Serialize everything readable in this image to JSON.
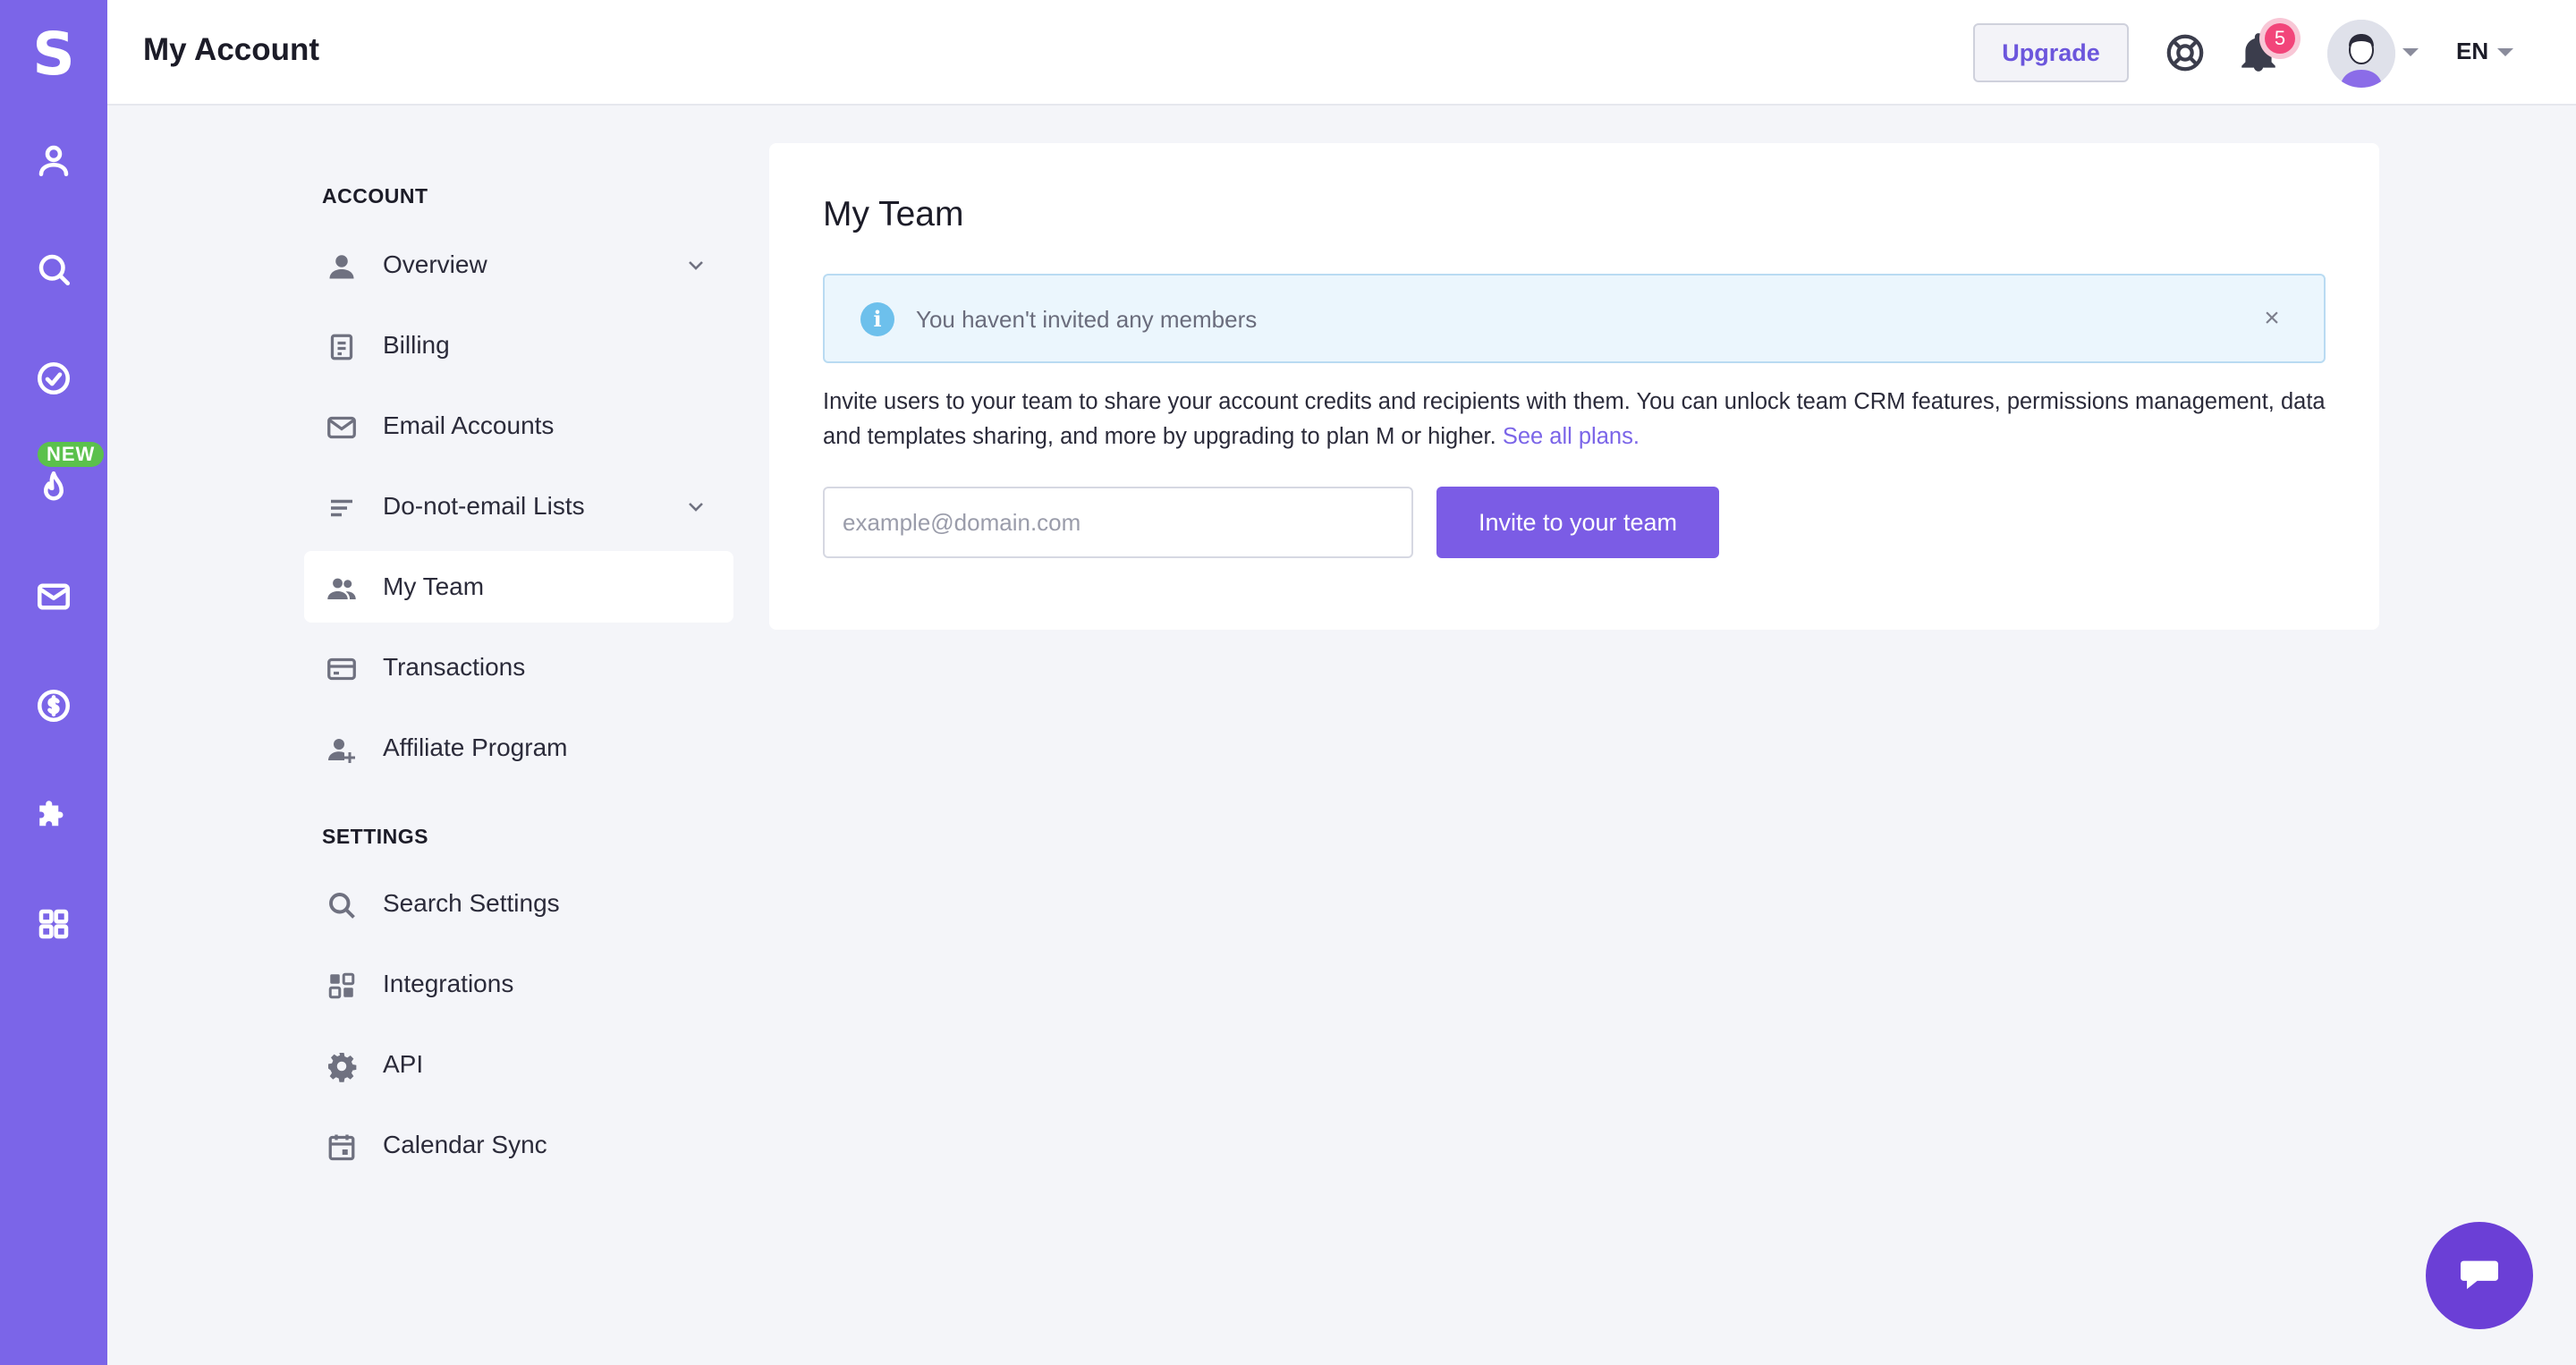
{
  "rail": {
    "logo": "S",
    "new_badge": "NEW",
    "items": [
      {
        "icon": "user-icon"
      },
      {
        "icon": "search-icon"
      },
      {
        "icon": "check-circle-icon"
      },
      {
        "icon": "flame-icon"
      },
      {
        "icon": "mail-icon"
      },
      {
        "icon": "dollar-icon"
      },
      {
        "icon": "puzzle-icon"
      },
      {
        "icon": "apps-grid-icon"
      }
    ],
    "color": "#7b65e8"
  },
  "header": {
    "title": "My Account",
    "upgrade_label": "Upgrade",
    "notification_count": "5",
    "language": "EN"
  },
  "nav": {
    "account_heading": "ACCOUNT",
    "settings_heading": "SETTINGS",
    "account_items": [
      {
        "label": "Overview",
        "icon": "person-icon"
      },
      {
        "label": "Billing",
        "icon": "document-icon"
      },
      {
        "label": "Email Accounts",
        "icon": "envelope-icon"
      },
      {
        "label": "Do-not-email Lists",
        "icon": "list-icon"
      },
      {
        "label": "My Team",
        "icon": "team-icon"
      },
      {
        "label": "Transactions",
        "icon": "card-icon"
      },
      {
        "label": "Affiliate Program",
        "icon": "person-add-icon"
      }
    ],
    "settings_items": [
      {
        "label": "Search Settings",
        "icon": "magnifier-icon"
      },
      {
        "label": "Integrations",
        "icon": "integrations-icon"
      },
      {
        "label": "API",
        "icon": "gear-icon"
      },
      {
        "label": "Calendar Sync",
        "icon": "calendar-icon"
      }
    ],
    "active": "My Team"
  },
  "main": {
    "title": "My Team",
    "alert": "You haven't invited any members",
    "description": "Invite users to your team to share your account credits and recipients with them. You can unlock team CRM features, permissions management, data and templates sharing, and more by upgrading to plan M or higher.",
    "link": "See all plans.",
    "email_placeholder": "example@domain.com",
    "invite_label": "Invite to your team"
  },
  "colors": {
    "accent": "#7b5ce5",
    "alert_bg": "#ebf6fd",
    "badge": "#f2457a",
    "new_badge": "#5bc14c"
  }
}
